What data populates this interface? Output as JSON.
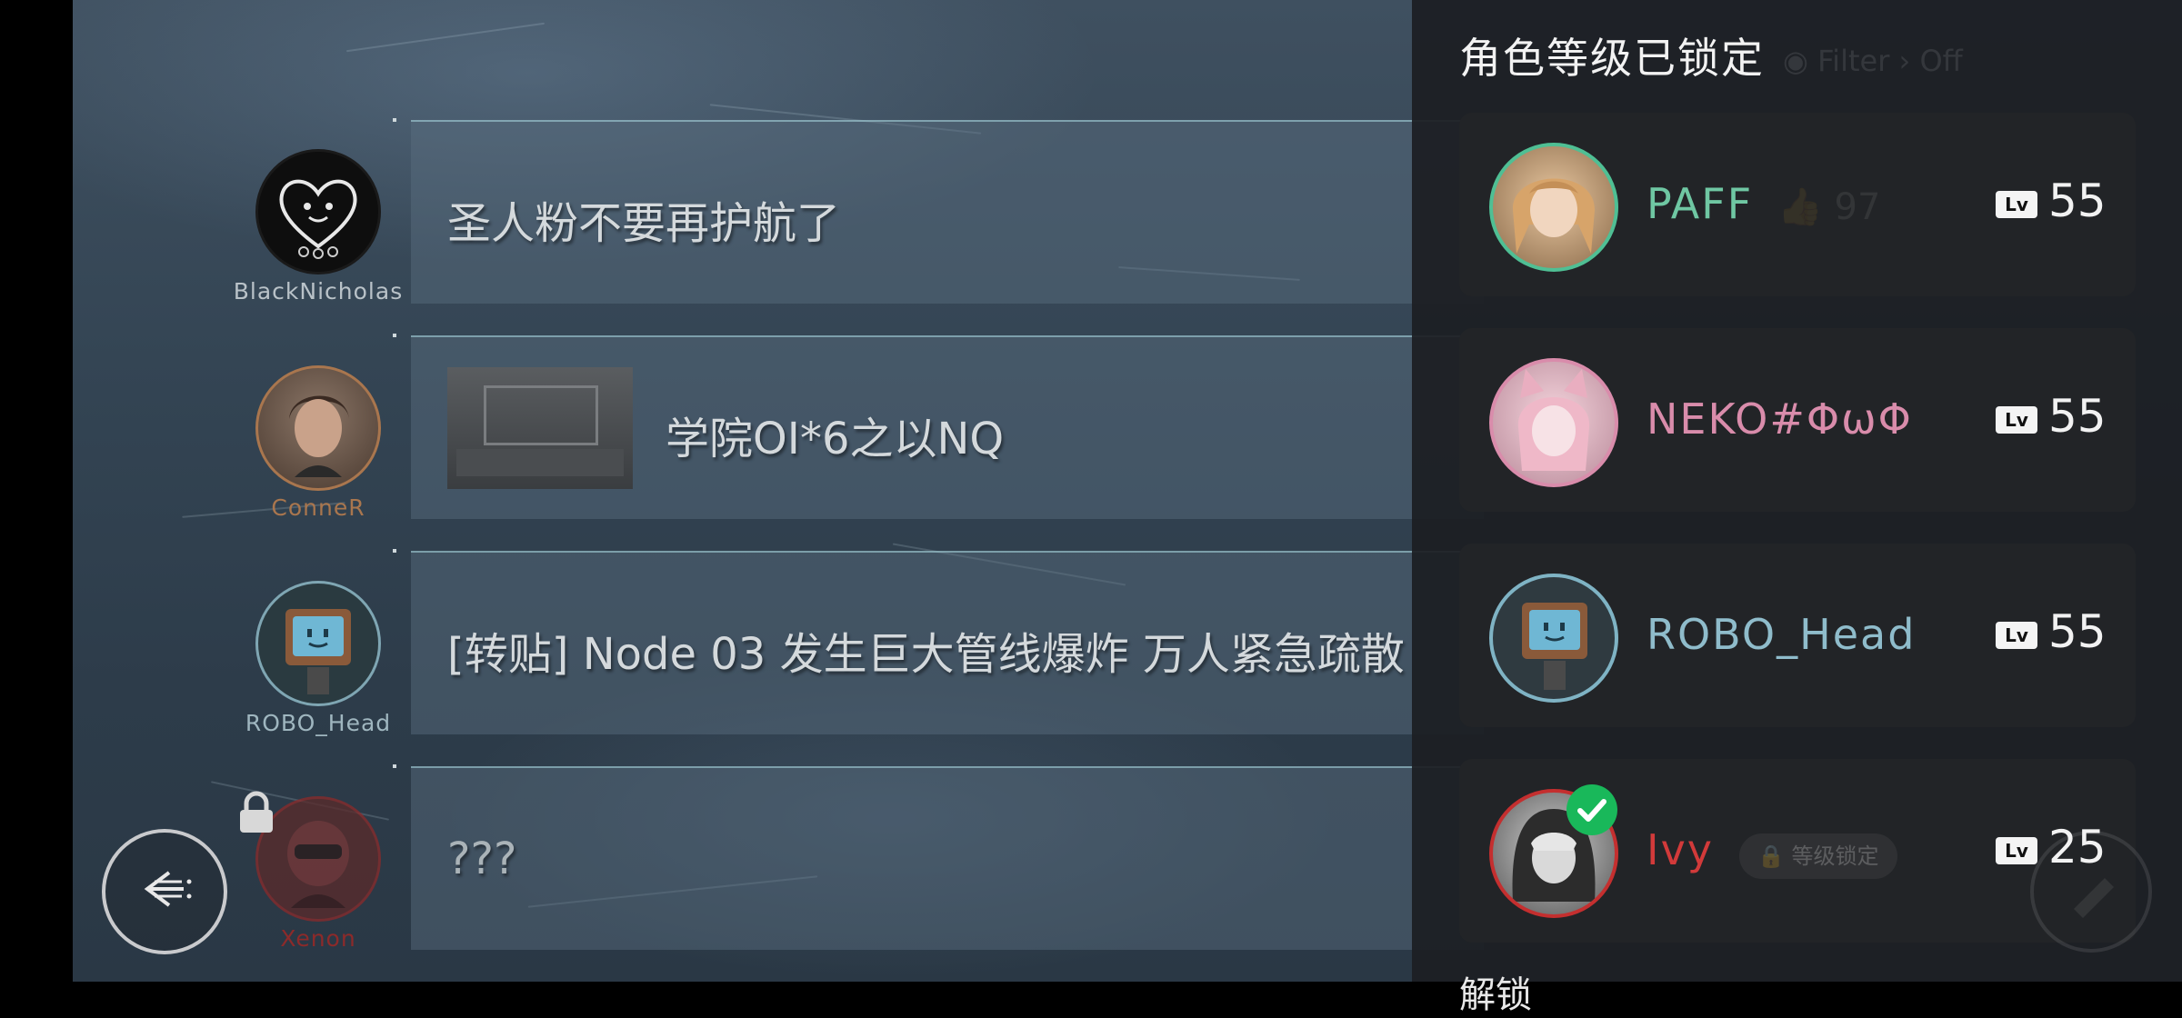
{
  "posts": [
    {
      "author": "BlackNicholas",
      "author_color": "#b9c2c8",
      "text": "圣人粉不要再护航了"
    },
    {
      "author": "ConneR",
      "author_color": "#a9764e",
      "text": "学院OI*6之以NQ"
    },
    {
      "author": "ROBO_Head",
      "author_color": "#9fb6bf",
      "text": "[转贴] Node 03 发生巨大管线爆炸 万人紧急疏散"
    },
    {
      "author": "Xenon",
      "author_color": "#8c2a2a",
      "text": "???"
    }
  ],
  "panel": {
    "title": "角色等级已锁定",
    "filter_label": "Filter",
    "filter_value": "Off",
    "lv_label": "Lv",
    "characters": [
      {
        "name": "PAFF",
        "name_color": "#6fc7a3",
        "ring_color": "#4fbf94",
        "level": "55",
        "likes": "97"
      },
      {
        "name": "NEKO#ΦωΦ",
        "name_color": "#d98cab",
        "ring_color": "#d98cab",
        "level": "55"
      },
      {
        "name": "ROBO_Head",
        "name_color": "#8fbccb",
        "ring_color": "#7fb3c4",
        "level": "55"
      },
      {
        "name": "Ivy",
        "name_color": "#d23a3a",
        "ring_color": "#c42f2f",
        "level": "25",
        "status": "等级锁定",
        "selected": true
      }
    ],
    "section_label": "解锁"
  },
  "icons": {
    "back": "back-arrow-icon",
    "lock": "lock-icon",
    "check": "check-icon"
  }
}
